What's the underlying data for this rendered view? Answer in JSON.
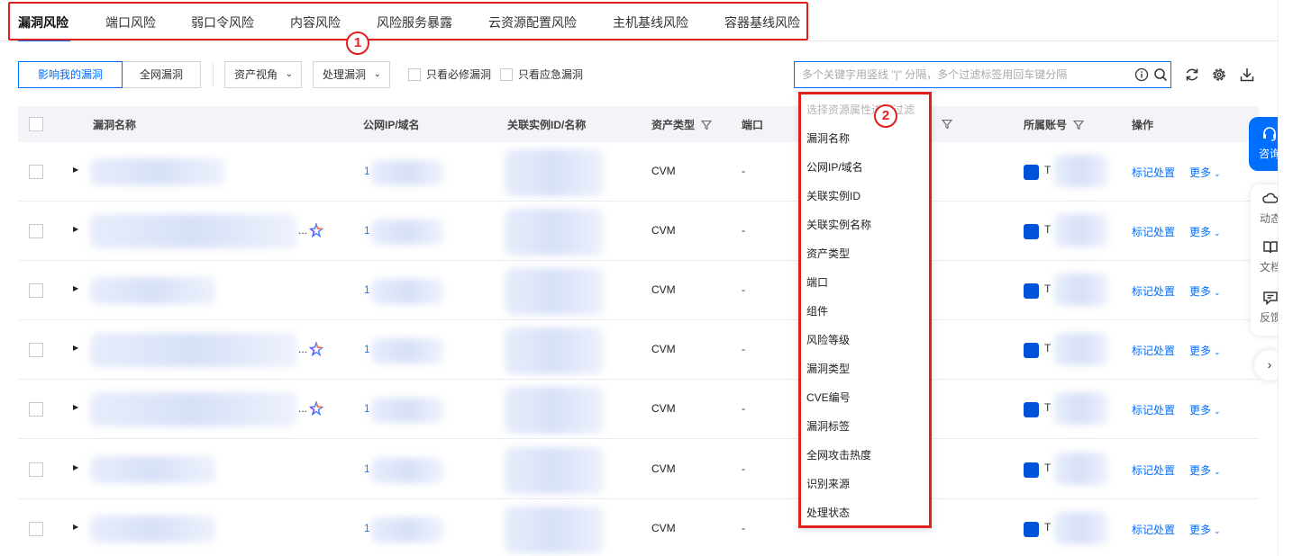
{
  "tabs": [
    "漏洞风险",
    "端口风险",
    "弱口令风险",
    "内容风险",
    "风险服务暴露",
    "云资源配置风险",
    "主机基线风险",
    "容器基线风险"
  ],
  "annotations": [
    "1",
    "2"
  ],
  "toolbar": {
    "seg_affecting": "影响我的漏洞",
    "seg_all": "全网漏洞",
    "asset_view": "资产视角",
    "handle_vuln": "处理漏洞",
    "only_must_fix": "只看必修漏洞",
    "only_emergency": "只看应急漏洞",
    "search_placeholder": "多个关键字用竖线 \"|\" 分隔，多个过滤标签用回车键分隔"
  },
  "table": {
    "headers": {
      "name": "漏洞名称",
      "ip": "公网IP/域名",
      "instance": "关联实例ID/名称",
      "asset_type": "资产类型",
      "port": "端口",
      "account": "所属账号",
      "ops": "操作"
    },
    "rows": [
      {
        "ip": "1",
        "type": "CVM",
        "port": "-",
        "acct": "T",
        "action": "标记处置",
        "more": "更多"
      },
      {
        "ellipsis": "...",
        "ip": "1",
        "type": "CVM",
        "port": "-",
        "acct": "T",
        "action": "标记处置",
        "more": "更多"
      },
      {
        "ip": "1",
        "type": "CVM",
        "port": "-",
        "acct": "T",
        "action": "标记处置",
        "more": "更多"
      },
      {
        "ellipsis": "...",
        "ip": "1",
        "type": "CVM",
        "port": "-",
        "acct": "T",
        "action": "标记处置",
        "more": "更多"
      },
      {
        "ellipsis": "...",
        "ip": "1",
        "type": "CVM",
        "port": "-",
        "acct": "T",
        "action": "标记处置",
        "more": "更多"
      },
      {
        "ip": "1",
        "type": "CVM",
        "port": "-",
        "acct": "T",
        "action": "标记处置",
        "more": "更多"
      },
      {
        "ip": "1",
        "type": "CVM",
        "port": "-",
        "acct": "T",
        "action": "标记处置",
        "more": "更多"
      }
    ]
  },
  "dropdown": {
    "header": "选择资源属性进行过滤",
    "items": [
      "漏洞名称",
      "公网IP/域名",
      "关联实例ID",
      "关联实例名称",
      "资产类型",
      "端口",
      "组件",
      "风险等级",
      "漏洞类型",
      "CVE编号",
      "漏洞标签",
      "全网攻击热度",
      "识别来源",
      "处理状态"
    ]
  },
  "side": {
    "consult": "咨询",
    "dynamic": "动态",
    "docs": "文档",
    "feedback": "反馈"
  },
  "colors": {
    "accent": "#006eff",
    "annotation_red": "#e0201d"
  }
}
